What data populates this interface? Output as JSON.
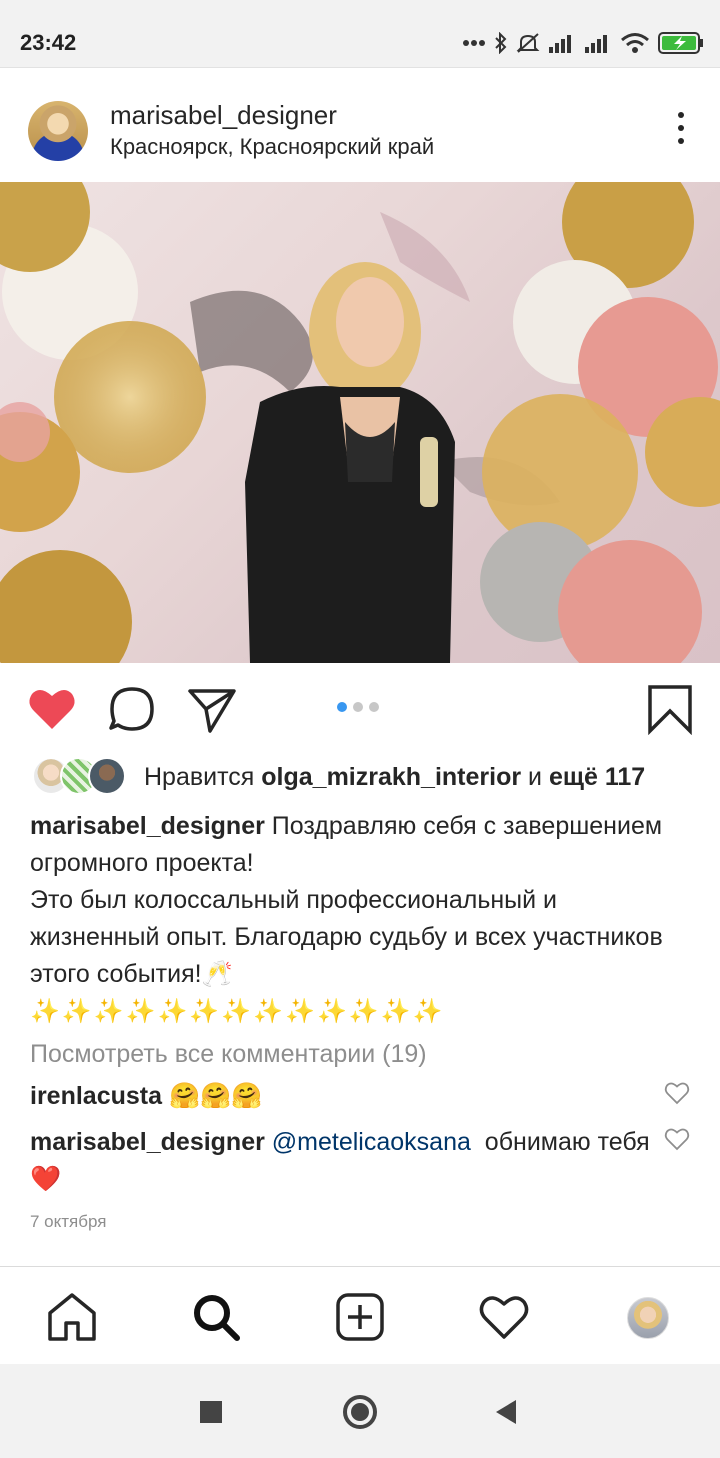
{
  "status_bar": {
    "time": "23:42",
    "icons": [
      "more-dots-icon",
      "bluetooth-icon",
      "mute-icon",
      "signal-icon",
      "signal-icon",
      "wifi-icon",
      "battery-charging-icon"
    ],
    "battery_color": "#3dbb3d"
  },
  "post": {
    "username": "marisabel_designer",
    "location": "Красноярск, Красноярский край",
    "image_alt": "photo-post",
    "carousel": {
      "count": 3,
      "active": 1
    },
    "likes": {
      "prefix": "Нравится",
      "liker": "olga_mizrakh_interior",
      "conjunction": "и",
      "others": "ещё 117"
    },
    "caption": {
      "username": "marisabel_designer",
      "text_line1": "Поздравляю себя с завершением огромного проекта!",
      "text_line2": "Это был колоссальный профессиональный и жизненный опыт. Благодарю судьбу и всех участников этого события!",
      "emoji_glass": "🥂",
      "sparkles": "✨✨✨✨✨✨✨✨✨✨✨✨✨"
    },
    "view_all_comments": "Посмотреть все комментарии (19)",
    "comments": [
      {
        "username": "irenlacusta",
        "text": "🤗🤗🤗"
      },
      {
        "username": "marisabel_designer",
        "mention": "@metelicaoksana",
        "text": "обнимаю тебя",
        "emoji": "❤️"
      }
    ],
    "date": "7 октября",
    "like_color": "#ed4956"
  },
  "bottom_nav": [
    "home-icon",
    "search-icon",
    "add-post-icon",
    "activity-heart-icon",
    "profile-avatar"
  ],
  "system_nav": [
    "recents-square-icon",
    "home-circle-icon",
    "back-triangle-icon"
  ]
}
